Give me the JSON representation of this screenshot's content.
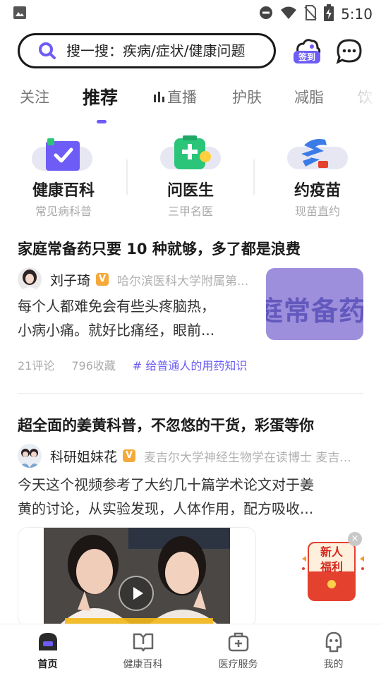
{
  "status_bar": {
    "time": "5:10"
  },
  "search": {
    "placeholder": "搜一搜：疾病/症状/健康问题"
  },
  "checkin": {
    "label": "签到"
  },
  "tabs": [
    {
      "label": "关注"
    },
    {
      "label": "推荐",
      "active": true
    },
    {
      "label": "直播"
    },
    {
      "label": "护肤"
    },
    {
      "label": "减脂"
    },
    {
      "label": "饮"
    }
  ],
  "services": [
    {
      "title": "健康百科",
      "subtitle": "常见病科普"
    },
    {
      "title": "问医生",
      "subtitle": "三甲名医"
    },
    {
      "title": "约疫苗",
      "subtitle": "现苗直约"
    }
  ],
  "feed": {
    "articles": [
      {
        "title": "家庭常备药只要 10 种就够，多了都是浪费",
        "author": "刘子琦",
        "badge": "V",
        "affiliation": "哈尔滨医科大学附属第...",
        "excerpt_line1": "每个人都难免会有些头疼脑热，",
        "excerpt_line2": "小病小痛。就好比痛经，眼前...",
        "thumb_text": "庭常备药",
        "comments": "21评论",
        "favorites": "796收藏",
        "tag": "# 给普通人的用药知识"
      },
      {
        "title": "超全面的姜黄科普，不忽悠的干货，彩蛋等你",
        "author": "科研姐妹花",
        "badge": "V",
        "affiliation": "麦吉尔大学神经生物学在读博士 麦吉...",
        "excerpt_line1": "今天这个视频参考了大约几十篇学术论文对于姜",
        "excerpt_line2": "黄的讨论，从实验发现，人体作用，配方吸收..."
      }
    ]
  },
  "promo": {
    "line1": "新人",
    "line2": "福利",
    "close": "×"
  },
  "bottom_nav": [
    {
      "label": "首页",
      "active": true
    },
    {
      "label": "健康百科"
    },
    {
      "label": "医疗服务"
    },
    {
      "label": "我的"
    }
  ],
  "colors": {
    "accent": "#6d5cf5",
    "promo_red": "#e4412f",
    "badge_orange": "#f4a93a"
  }
}
